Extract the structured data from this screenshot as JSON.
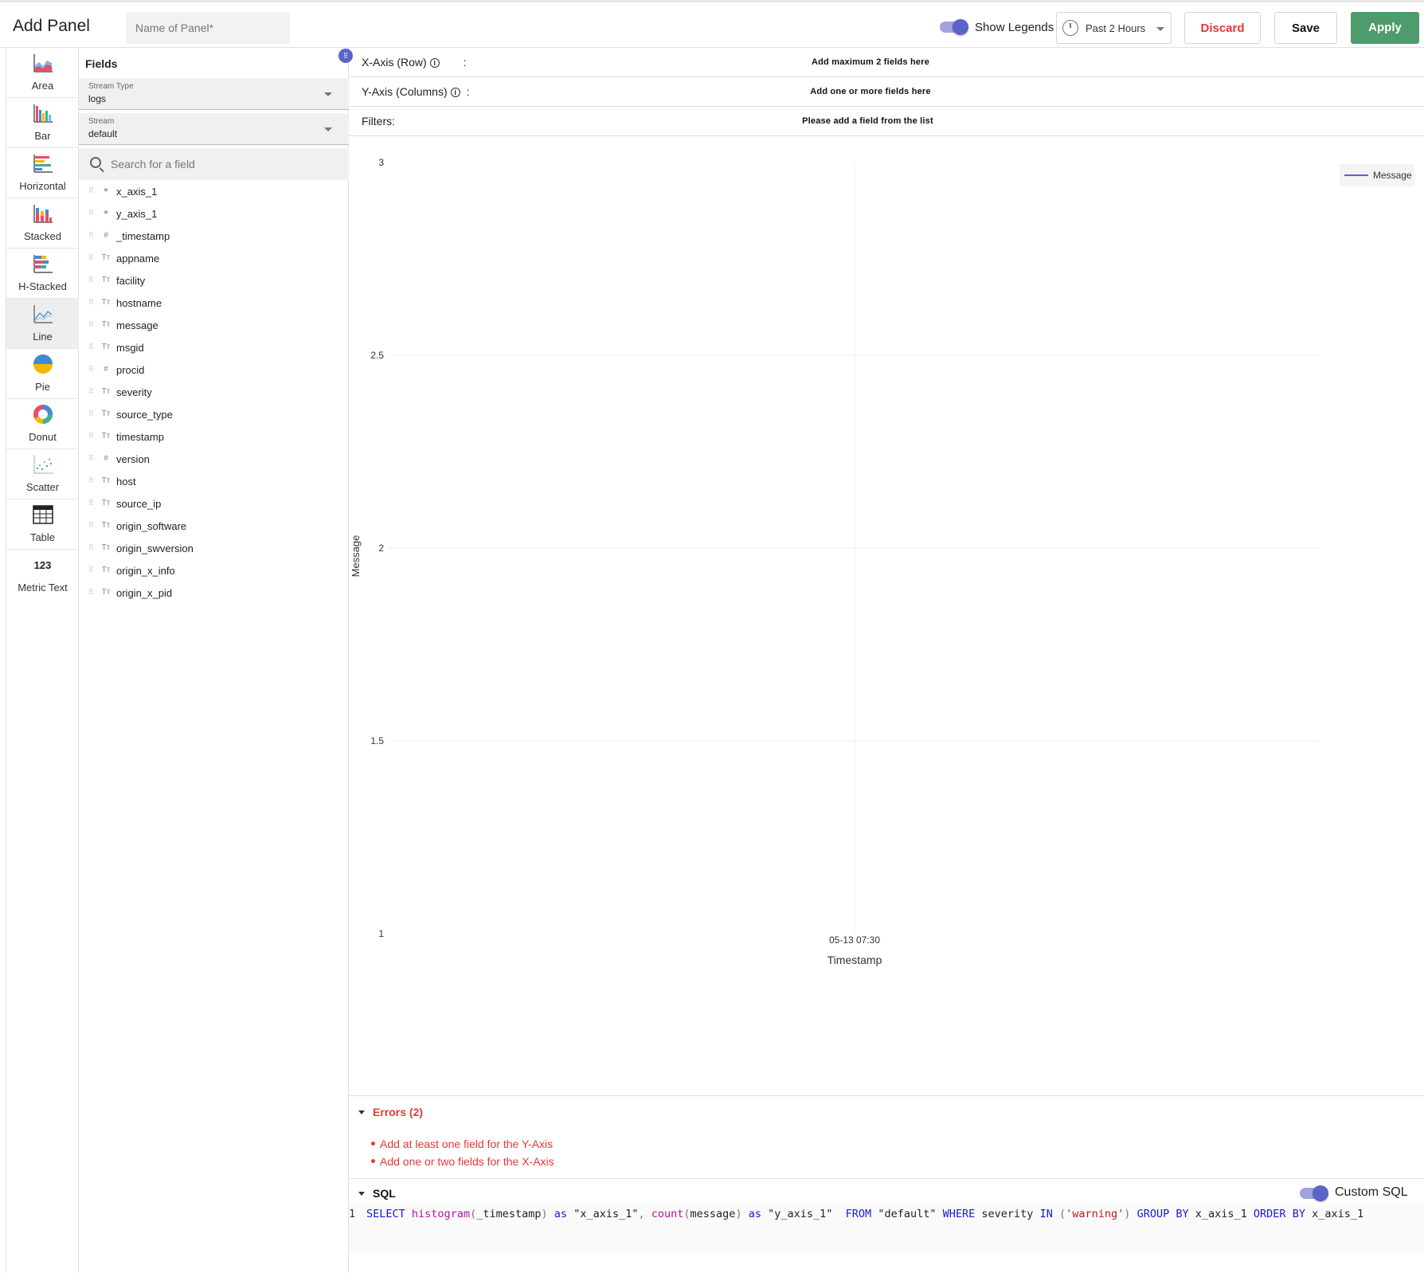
{
  "header": {
    "title": "Add Panel",
    "panel_name_placeholder": "Name of Panel*",
    "show_legends_label": "Show Legends",
    "time_range": "Past 2 Hours",
    "discard_label": "Discard",
    "save_label": "Save",
    "apply_label": "Apply"
  },
  "chart_types": [
    {
      "label": "Area",
      "icon": "area-chart-icon"
    },
    {
      "label": "Bar",
      "icon": "bar-chart-icon"
    },
    {
      "label": "Horizontal",
      "icon": "horizontal-bar-icon"
    },
    {
      "label": "Stacked",
      "icon": "stacked-bar-icon"
    },
    {
      "label": "H-Stacked",
      "icon": "h-stacked-bar-icon"
    },
    {
      "label": "Line",
      "icon": "line-chart-icon",
      "selected": true
    },
    {
      "label": "Pie",
      "icon": "pie-chart-icon"
    },
    {
      "label": "Donut",
      "icon": "donut-chart-icon"
    },
    {
      "label": "Scatter",
      "icon": "scatter-chart-icon"
    },
    {
      "label": "Table",
      "icon": "table-icon"
    },
    {
      "label": "Metric Text",
      "icon": "metric-text-icon",
      "glyph": "123"
    }
  ],
  "fields_panel": {
    "title": "Fields",
    "stream_type_label": "Stream Type",
    "stream_type_value": "logs",
    "stream_label": "Stream",
    "stream_value": "default",
    "search_placeholder": "Search for a field",
    "fields": [
      {
        "name": "x_axis_1",
        "type": "toggle"
      },
      {
        "name": "y_axis_1",
        "type": "toggle"
      },
      {
        "name": "_timestamp",
        "type": "number"
      },
      {
        "name": "appname",
        "type": "text"
      },
      {
        "name": "facility",
        "type": "text"
      },
      {
        "name": "hostname",
        "type": "text"
      },
      {
        "name": "message",
        "type": "text"
      },
      {
        "name": "msgid",
        "type": "text"
      },
      {
        "name": "procid",
        "type": "number"
      },
      {
        "name": "severity",
        "type": "text"
      },
      {
        "name": "source_type",
        "type": "text"
      },
      {
        "name": "timestamp",
        "type": "text"
      },
      {
        "name": "version",
        "type": "number"
      },
      {
        "name": "host",
        "type": "text"
      },
      {
        "name": "source_ip",
        "type": "text"
      },
      {
        "name": "origin_software",
        "type": "text"
      },
      {
        "name": "origin_swversion",
        "type": "text"
      },
      {
        "name": "origin_x_info",
        "type": "text"
      },
      {
        "name": "origin_x_pid",
        "type": "text"
      }
    ]
  },
  "axes": {
    "x_label": "X-Axis (Row)",
    "x_hint": "Add maximum 2 fields here",
    "y_label": "Y-Axis (Columns)",
    "y_hint": "Add one or more fields here",
    "filters_label": "Filters:",
    "filters_hint": "Please add a field from the list",
    "colon": ":"
  },
  "chart_data": {
    "type": "line",
    "title": "",
    "xlabel": "Timestamp",
    "ylabel": "Message",
    "x_ticks": [
      "05-13 07:30"
    ],
    "y_ticks": [
      "3",
      "2.5",
      "2",
      "1.5",
      "1"
    ],
    "ylim": [
      1,
      3
    ],
    "series": [
      {
        "name": "Message",
        "values": [],
        "color": "#5c63c7"
      }
    ],
    "legend": "top-right",
    "grid": true
  },
  "errors": {
    "title": "Errors (2)",
    "items": [
      "Add at least one field for the Y-Axis",
      "Add one or two fields for the X-Axis"
    ]
  },
  "sql": {
    "title": "SQL",
    "custom_sql_label": "Custom SQL",
    "line_number": "1",
    "query": "SELECT histogram(_timestamp) as \"x_axis_1\", count(message) as \"y_axis_1\"  FROM \"default\" WHERE severity IN ('warning') GROUP BY x_axis_1 ORDER BY x_axis_1"
  },
  "colors": {
    "accent": "#5c63c7",
    "apply": "#4e9b6b",
    "error": "#e53935"
  }
}
